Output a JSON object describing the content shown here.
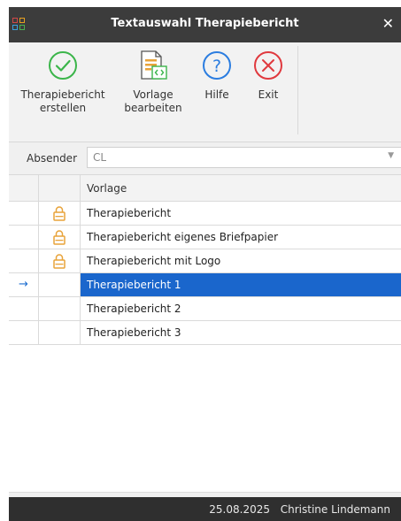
{
  "window": {
    "title": "Textauswahl Therapiebericht",
    "close_label": "✕"
  },
  "toolbar": {
    "buttons": [
      {
        "label_line1": "Therapiebericht",
        "label_line2": "erstellen",
        "icon": "check-circle-icon"
      },
      {
        "label_line1": "Vorlage",
        "label_line2": "bearbeiten",
        "icon": "document-code-icon"
      },
      {
        "label_line1": "Hilfe",
        "label_line2": "",
        "icon": "help-circle-icon"
      },
      {
        "label_line1": "Exit",
        "label_line2": "",
        "icon": "close-circle-icon"
      }
    ]
  },
  "absender": {
    "label": "Absender",
    "value": "CL",
    "dropdown_icon": "chevron-down-icon"
  },
  "grid": {
    "header": "Vorlage",
    "rows": [
      {
        "name": "Therapiebericht",
        "locked": true,
        "selected": false
      },
      {
        "name": "Therapiebericht eigenes Briefpapier",
        "locked": true,
        "selected": false
      },
      {
        "name": "Therapiebericht mit Logo",
        "locked": true,
        "selected": false
      },
      {
        "name": "Therapiebericht 1",
        "locked": false,
        "selected": true
      },
      {
        "name": "Therapiebericht 2",
        "locked": false,
        "selected": false
      },
      {
        "name": "Therapiebericht 3",
        "locked": false,
        "selected": false
      }
    ],
    "current_row_marker": "→"
  },
  "footer": {
    "date": "25.08.2025",
    "user": "Christine Lindemann"
  },
  "colors": {
    "titlebar": "#3c3c3c",
    "selection": "#1a66cc",
    "check_green": "#3bb54a",
    "help_blue": "#2b7de0",
    "exit_red": "#e0393e",
    "lock_orange": "#e8a33a",
    "footer": "#2f2f2f"
  }
}
